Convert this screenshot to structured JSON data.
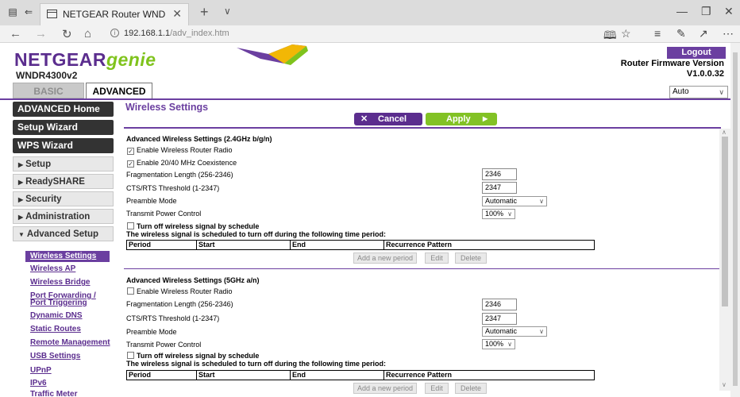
{
  "browser": {
    "tab_title": "NETGEAR Router WNDF",
    "url_host": "192.168.1.1",
    "url_path": "/adv_index.htm"
  },
  "header": {
    "logo_brand": "NETGEAR",
    "logo_product": "genie",
    "model": "WNDR4300v2",
    "logout_label": "Logout",
    "firmware_label": "Router Firmware Version",
    "firmware_version": "V1.0.0.32",
    "language_selected": "Auto"
  },
  "tabs": {
    "basic": "BASIC",
    "advanced": "ADVANCED"
  },
  "sidebar": {
    "main_buttons": [
      "ADVANCED Home",
      "Setup Wizard",
      "WPS Wizard"
    ],
    "groups": [
      "Setup",
      "ReadySHARE",
      "Security",
      "Administration",
      "Advanced Setup"
    ],
    "sub_items": [
      "Wireless Settings",
      "Wireless AP",
      "Wireless Bridge",
      "Port Forwarding /",
      "Port Triggering",
      "Dynamic DNS",
      "Static Routes",
      "Remote Management",
      "USB Settings",
      "UPnP",
      "IPv6",
      "Traffic Meter"
    ]
  },
  "content": {
    "title": "Wireless Settings",
    "cancel_label": "Cancel",
    "apply_label": "Apply",
    "section_24": {
      "title": "Advanced Wireless Settings (2.4GHz b/g/n)",
      "enable_radio_label": "Enable Wireless Router Radio",
      "enable_radio_checked": true,
      "coexistence_label": "Enable 20/40 MHz Coexistence",
      "coexistence_checked": true,
      "frag_label": "Fragmentation Length (256-2346)",
      "frag_value": "2346",
      "cts_label": "CTS/RTS Threshold (1-2347)",
      "cts_value": "2347",
      "preamble_label": "Preamble Mode",
      "preamble_value": "Automatic",
      "power_label": "Transmit Power Control",
      "power_value": "100%",
      "schedule_label": "Turn off wireless signal by schedule",
      "schedule_note": "The wireless signal is scheduled to turn off during the following time period:",
      "col_period": "Period",
      "col_start": "Start",
      "col_end": "End",
      "col_pattern": "Recurrence Pattern",
      "add_period": "Add a new period",
      "edit": "Edit",
      "delete": "Delete"
    },
    "section_5": {
      "title": "Advanced Wireless Settings (5GHz a/n)",
      "enable_radio_label": "Enable Wireless Router Radio",
      "enable_radio_checked": false,
      "frag_label": "Fragmentation Length (256-2346)",
      "frag_value": "2346",
      "cts_label": "CTS/RTS Threshold (1-2347)",
      "cts_value": "2347",
      "preamble_label": "Preamble Mode",
      "preamble_value": "Automatic",
      "power_label": "Transmit Power Control",
      "power_value": "100%",
      "schedule_label": "Turn off wireless signal by schedule",
      "schedule_note": "The wireless signal is scheduled to turn off during the following time period:",
      "col_period": "Period",
      "col_start": "Start",
      "col_end": "End",
      "col_pattern": "Recurrence Pattern",
      "add_period": "Add a new period",
      "edit": "Edit",
      "delete": "Delete"
    }
  },
  "colors": {
    "brand_purple": "#6b3fa0",
    "brand_green": "#82c225"
  },
  "icons": [
    "tab-preview-icon",
    "back-tabs-icon",
    "page-icon",
    "close-icon",
    "plus-icon",
    "chevron-down-icon",
    "minimize-icon",
    "restore-icon",
    "back-arrow-icon",
    "forward-arrow-icon",
    "refresh-icon",
    "home-icon",
    "info-icon",
    "reading-view-icon",
    "star-icon",
    "favorites-icon",
    "pen-icon",
    "share-icon",
    "more-icon"
  ]
}
